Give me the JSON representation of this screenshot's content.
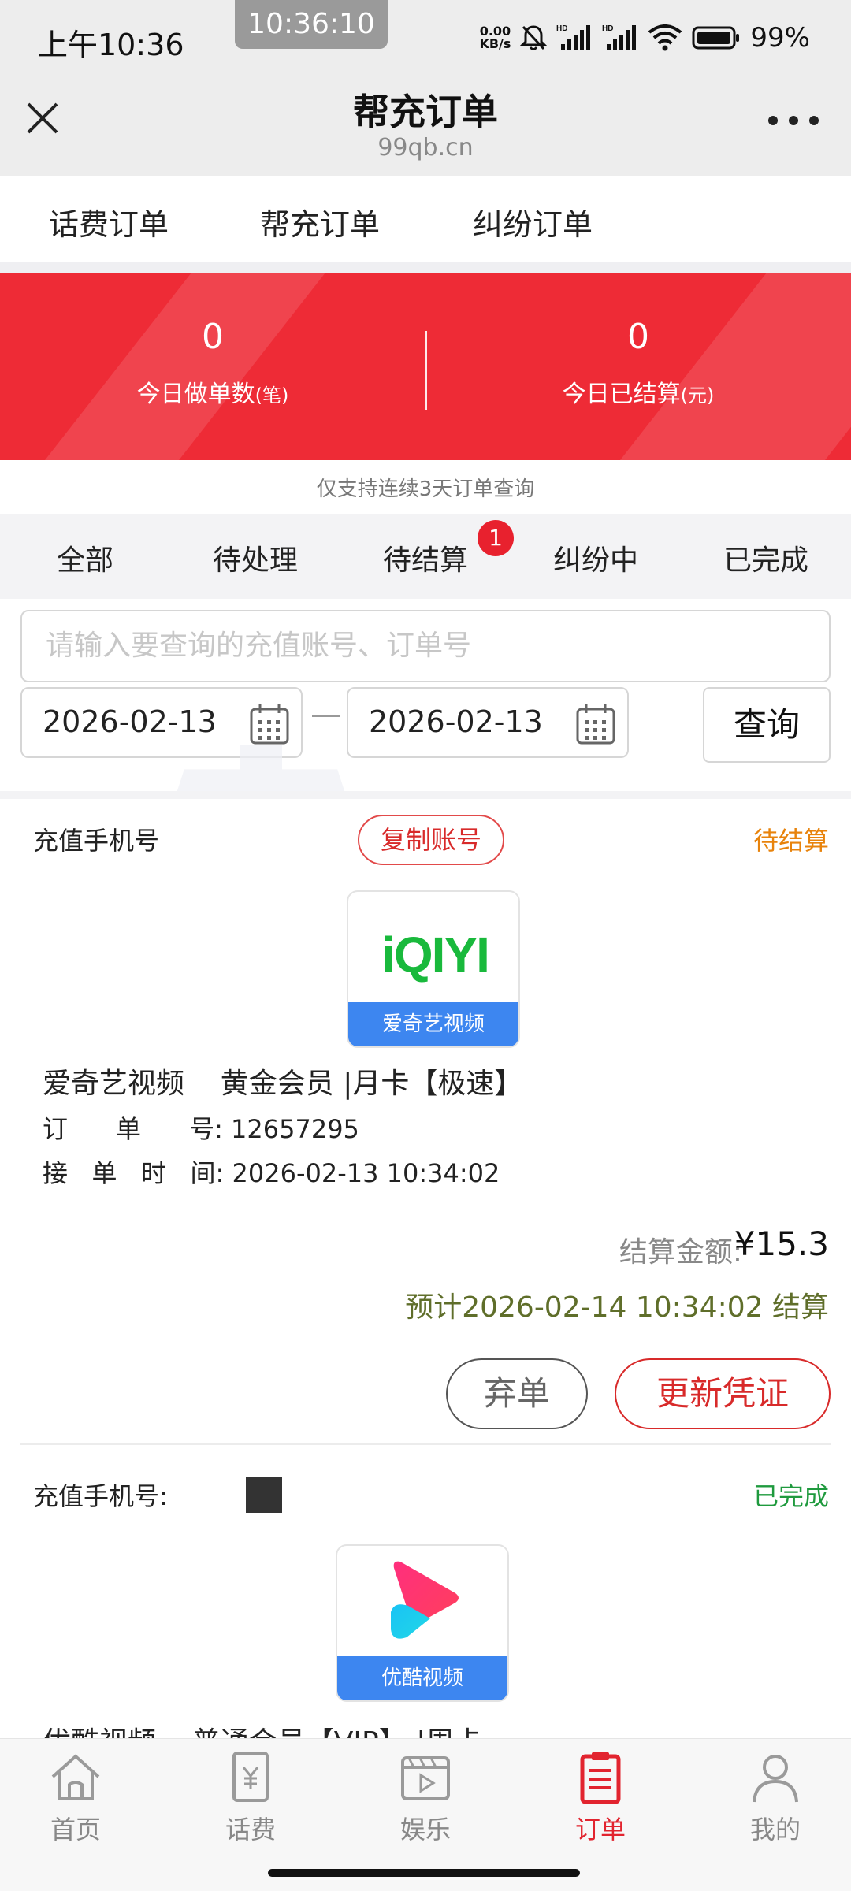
{
  "status_bar": {
    "time": "上午10:36",
    "clock_overlay": "10:36:10",
    "net_speed_value": "0.00",
    "net_speed_unit": "KB/s",
    "battery": "99%"
  },
  "header": {
    "title": "帮充订单",
    "domain": "99qb.cn"
  },
  "top_tabs": [
    {
      "label": "话费订单",
      "active": false
    },
    {
      "label": "帮充订单",
      "active": true
    },
    {
      "label": "纠纷订单",
      "active": false
    }
  ],
  "stats": {
    "orders_today_value": "0",
    "orders_today_label": "今日做单数",
    "orders_today_unit": "(笔)",
    "settled_today_value": "0",
    "settled_today_label": "今日已结算",
    "settled_today_unit": "(元)"
  },
  "notice": "仅支持连续3天订单查询",
  "filter_tabs": [
    {
      "label": "全部",
      "active": true
    },
    {
      "label": "待处理",
      "active": false
    },
    {
      "label": "待结算",
      "active": false,
      "badge": "1"
    },
    {
      "label": "纠纷中",
      "active": false
    },
    {
      "label": "已完成",
      "active": false
    }
  ],
  "search": {
    "placeholder": "请输入要查询的充值账号、订单号",
    "start_date": "2026-02-13",
    "end_date": "2026-02-13",
    "query_label": "查询"
  },
  "orders": [
    {
      "phone_label": "充值手机号",
      "copy_label": "复制账号",
      "status": "待结算",
      "status_color": "#e8830c",
      "logo_text": "iQIYI",
      "logo_caption": "爱奇艺视频",
      "title": "爱奇艺视频    黄金会员 |月卡【极速】",
      "order_no_label": "订      单      号:",
      "order_no": "12657295",
      "time_label": "接   单   时   间:",
      "time": "2026-02-13 10:34:02",
      "amount_label": "结算金额:",
      "amount": "¥15.3",
      "expected": "预计2026-02-14 10:34:02 结算",
      "abandon_label": "弃单",
      "update_label": "更新凭证"
    },
    {
      "phone_label": "充值手机号:",
      "status": "已完成",
      "status_color": "#1f9a3e",
      "logo_caption": "优酷视频",
      "title": "优酷视频    普通会员【VIP】 |周卡"
    }
  ],
  "bottom_nav": [
    {
      "label": "首页",
      "icon": "home-icon",
      "active": false
    },
    {
      "label": "话费",
      "icon": "yuan-bill-icon",
      "active": false
    },
    {
      "label": "娱乐",
      "icon": "video-icon",
      "active": false
    },
    {
      "label": "订单",
      "icon": "order-icon",
      "active": true
    },
    {
      "label": "我的",
      "icon": "user-icon",
      "active": false
    }
  ],
  "colors": {
    "banner_red": "#ee2b36",
    "accent_gold": "#c9a27a",
    "active_red": "#e2242f"
  }
}
